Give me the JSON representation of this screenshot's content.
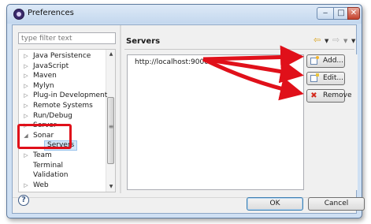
{
  "window": {
    "title": "Preferences"
  },
  "filter": {
    "placeholder": "type filter text"
  },
  "tree": {
    "items": [
      {
        "label": "Java Persistence",
        "expanded": false
      },
      {
        "label": "JavaScript",
        "expanded": false
      },
      {
        "label": "Maven",
        "expanded": false
      },
      {
        "label": "Mylyn",
        "expanded": false
      },
      {
        "label": "Plug-in Development",
        "expanded": false
      },
      {
        "label": "Remote Systems",
        "expanded": false
      },
      {
        "label": "Run/Debug",
        "expanded": false
      },
      {
        "label": "Server",
        "expanded": false
      },
      {
        "label": "Sonar",
        "expanded": true
      },
      {
        "label": "Servers",
        "child": true,
        "selected": true
      },
      {
        "label": "Team",
        "expanded": false
      },
      {
        "label": "Terminal"
      },
      {
        "label": "Validation"
      },
      {
        "label": "Web",
        "expanded": false
      }
    ]
  },
  "page": {
    "title": "Servers"
  },
  "servers": {
    "items": [
      "http://localhost:9000"
    ]
  },
  "buttons": {
    "add": "Add...",
    "edit": "Edit...",
    "remove": "Remove",
    "ok": "OK",
    "cancel": "Cancel"
  },
  "colors": {
    "annotation": "#e0101a",
    "selection": "#d3e6f8",
    "window_frame": "#cfe0f3"
  }
}
